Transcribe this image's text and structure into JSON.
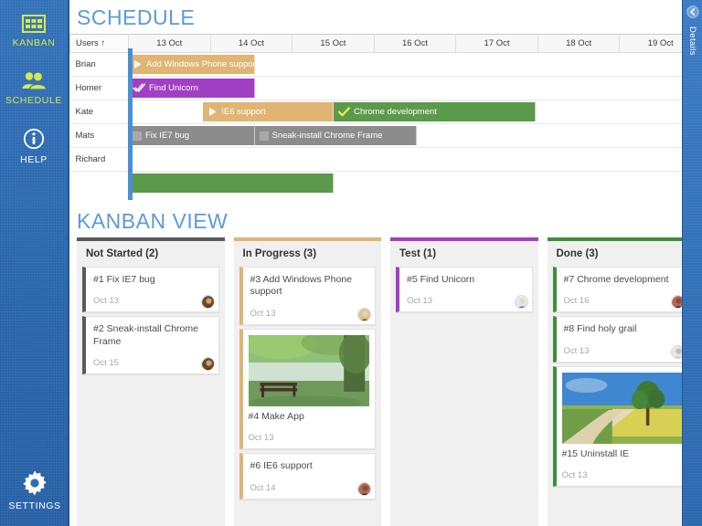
{
  "sidebar": {
    "items": [
      {
        "label": "KANBAN",
        "icon": "grid-icon",
        "style": "accent"
      },
      {
        "label": "SCHEDULE",
        "icon": "people-icon",
        "style": "accent"
      },
      {
        "label": "HELP",
        "icon": "info-icon",
        "style": "plain"
      }
    ],
    "settings": {
      "label": "SETTINGS",
      "icon": "gear-icon"
    }
  },
  "details_panel": {
    "label": "Details",
    "icon": "chevron-left-icon"
  },
  "schedule": {
    "title": "SCHEDULE",
    "users_header": "Users",
    "sort_arrow": "↑",
    "dates": [
      "13 Oct",
      "14 Oct",
      "15 Oct",
      "16 Oct",
      "17 Oct",
      "18 Oct",
      "19 Oct"
    ],
    "users": [
      "Brian",
      "Homer",
      "Kate",
      "Mats",
      "Richard"
    ],
    "bars": [
      {
        "row": 0,
        "label": "Add Windows Phone support",
        "color": "orange",
        "icon": "play-icon",
        "start": 0,
        "span": 1.6
      },
      {
        "row": 1,
        "label": "Find Unicorn",
        "color": "purple",
        "icon": "check2-icon",
        "start": 0,
        "span": 1.6
      },
      {
        "row": 2,
        "label": "IE6 support",
        "color": "orange",
        "icon": "play-icon",
        "start": 0.95,
        "span": 1.65
      },
      {
        "row": 2,
        "label": "Chrome development",
        "color": "green",
        "icon": "check-icon",
        "start": 2.6,
        "span": 2.55
      },
      {
        "row": 3,
        "label": "Fix IE7 bug",
        "color": "gray",
        "icon": "square-icon",
        "start": 0,
        "span": 1.6
      },
      {
        "row": 3,
        "label": "Sneak-install Chrome Frame",
        "color": "gray",
        "icon": "square-icon",
        "start": 1.6,
        "span": 2.05
      },
      {
        "row": 5,
        "label": "",
        "color": "green",
        "icon": "none",
        "start": 0,
        "span": 2.6
      }
    ]
  },
  "kanban": {
    "title": "KANBAN VIEW",
    "columns": [
      {
        "title": "Not Started (2)",
        "accent": "#5a5a5a",
        "cards": [
          {
            "title": "#1 Fix IE7 bug",
            "date": "Oct 13",
            "avatar": "user-avatar-brown",
            "thumb": null
          },
          {
            "title": "#2 Sneak-install Chrome Frame",
            "date": "Oct 15",
            "avatar": "user-avatar-brown",
            "thumb": null
          }
        ]
      },
      {
        "title": "In Progress (3)",
        "accent": "#e0b573",
        "cards": [
          {
            "title": "#3 Add Windows Phone support",
            "date": "Oct 13",
            "avatar": "user-avatar-tan",
            "thumb": null
          },
          {
            "title": "#4 Make App",
            "date": "Oct 13",
            "avatar": null,
            "thumb": "forest-lake-bench-photo"
          },
          {
            "title": "#6 IE6 support",
            "date": "Oct 14",
            "avatar": "user-avatar-dark",
            "thumb": null
          }
        ]
      },
      {
        "title": "Test (1)",
        "accent": "#a23fc4",
        "cards": [
          {
            "title": "#5 Find Unicorn",
            "date": "Oct 13",
            "avatar": "user-avatar-blue",
            "thumb": null
          }
        ]
      },
      {
        "title": "Done (3)",
        "accent": "#3f8f3a",
        "cards": [
          {
            "title": "#7 Chrome development",
            "date": "Oct 16",
            "avatar": "user-avatar-dark",
            "thumb": null
          },
          {
            "title": "#8 Find holy grail",
            "date": "Oct 13",
            "avatar": "user-avatar-placeholder",
            "thumb": null
          },
          {
            "title": "#15 Uninstall IE",
            "date": "Oct 13",
            "avatar": null,
            "thumb": "tree-field-path-photo"
          }
        ]
      }
    ]
  },
  "colors": {
    "brand_blue": "#2f6db5",
    "accent_yellow": "#d6e84a",
    "title_blue": "#5b9bd8",
    "orange": "#e0b573",
    "purple": "#a23fc4",
    "green": "#5b9a4a",
    "gray": "#8c8c8c",
    "today_line": "#4a8fd4"
  }
}
